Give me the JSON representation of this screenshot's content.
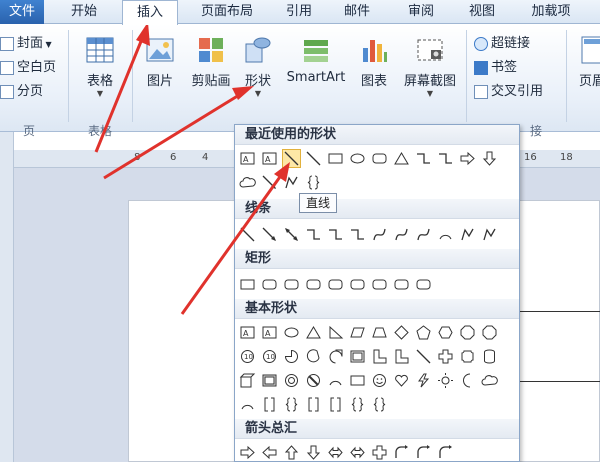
{
  "tabs": [
    {
      "label": "文件"
    },
    {
      "label": "开始"
    },
    {
      "label": "插入"
    },
    {
      "label": "页面布局"
    },
    {
      "label": "引用"
    },
    {
      "label": "邮件"
    },
    {
      "label": "审阅"
    },
    {
      "label": "视图"
    },
    {
      "label": "加载项"
    }
  ],
  "ribbon": {
    "pages_group": {
      "cover": "封面",
      "blank": "空白页",
      "page_break": "分页",
      "label": "页"
    },
    "table": {
      "label": "表格",
      "group_label": "表格"
    },
    "illustrations": {
      "picture": "图片",
      "clipart": "剪贴画",
      "shapes": "形状",
      "smartart": "SmartArt",
      "chart": "图表",
      "screenshot": "屏幕截图"
    },
    "links": {
      "hyperlink": "超链接",
      "bookmark": "书签",
      "crossref": "交叉引用",
      "group_label": "接"
    },
    "header": {
      "label": "页眉"
    }
  },
  "ruler": {
    "ticks": [
      "8",
      "6",
      "4",
      "16",
      "18"
    ]
  },
  "shapes_panel": {
    "recent": "最近使用的形状",
    "lines": "线条",
    "rect": "矩形",
    "basic": "基本形状",
    "arrows": "箭头总汇",
    "tooltip": "直线"
  },
  "colors": {
    "accent": "#e0322c",
    "ribbon": "#dde7f3",
    "file_tab": "#2a62ad"
  }
}
